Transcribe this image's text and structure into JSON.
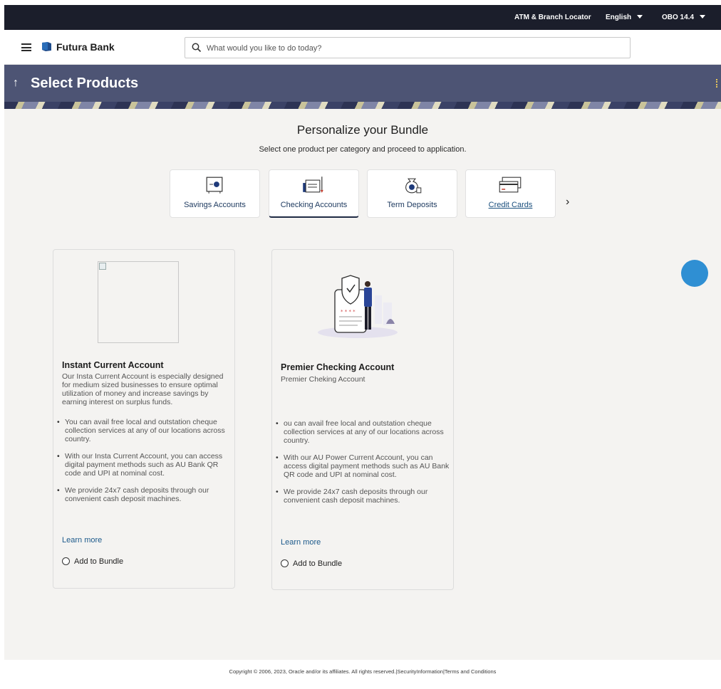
{
  "topbar": {
    "locator": "ATM & Branch Locator",
    "language": "English",
    "version": "OBO 14.4"
  },
  "header": {
    "brand": "Futura Bank",
    "search_placeholder": "What would you like to do today?"
  },
  "banner": {
    "title": "Select Products"
  },
  "personalize": {
    "heading": "Personalize your Bundle",
    "subheading": "Select one product per category and proceed to application."
  },
  "categories": [
    {
      "label": "Savings Accounts",
      "icon": "safe-icon"
    },
    {
      "label": "Checking Accounts",
      "icon": "checkbook-icon",
      "selected": true
    },
    {
      "label": "Term Deposits",
      "icon": "money-bag-icon"
    },
    {
      "label": "Credit Cards",
      "icon": "credit-card-icon"
    }
  ],
  "products": [
    {
      "name": "Instant Current Account",
      "description": "Our Insta Current Account is especially designed for medium sized businesses to ensure optimal utilization of money and increase savings by earning interest on surplus funds.",
      "bullets": [
        "You can avail free local and outstation cheque collection services at any of our locations across country.",
        "With our Insta Current Account, you can access digital payment methods such as AU Bank QR code and UPI at nominal cost.",
        "We provide 24x7 cash deposits through our convenient cash deposit machines."
      ],
      "learn_more": "Learn more",
      "add_to_bundle": "Add to Bundle"
    },
    {
      "name": "Premier Checking Account",
      "description": "Premier Cheking Account",
      "bullets": [
        "ou can avail free local and outstation cheque collection services at any of our locations across country.",
        "With our AU Power Current Account, you can access digital payment methods such as AU Bank QR code and UPI at nominal cost.",
        "We provide 24x7 cash deposits through our convenient cash deposit machines."
      ],
      "learn_more": "Learn more",
      "add_to_bundle": "Add to Bundle"
    }
  ],
  "footer": {
    "text": "Copyright © 2006, 2023, Oracle and/or its affiliates. All rights reserved.|SecurityInformation|Terms and Conditions"
  }
}
